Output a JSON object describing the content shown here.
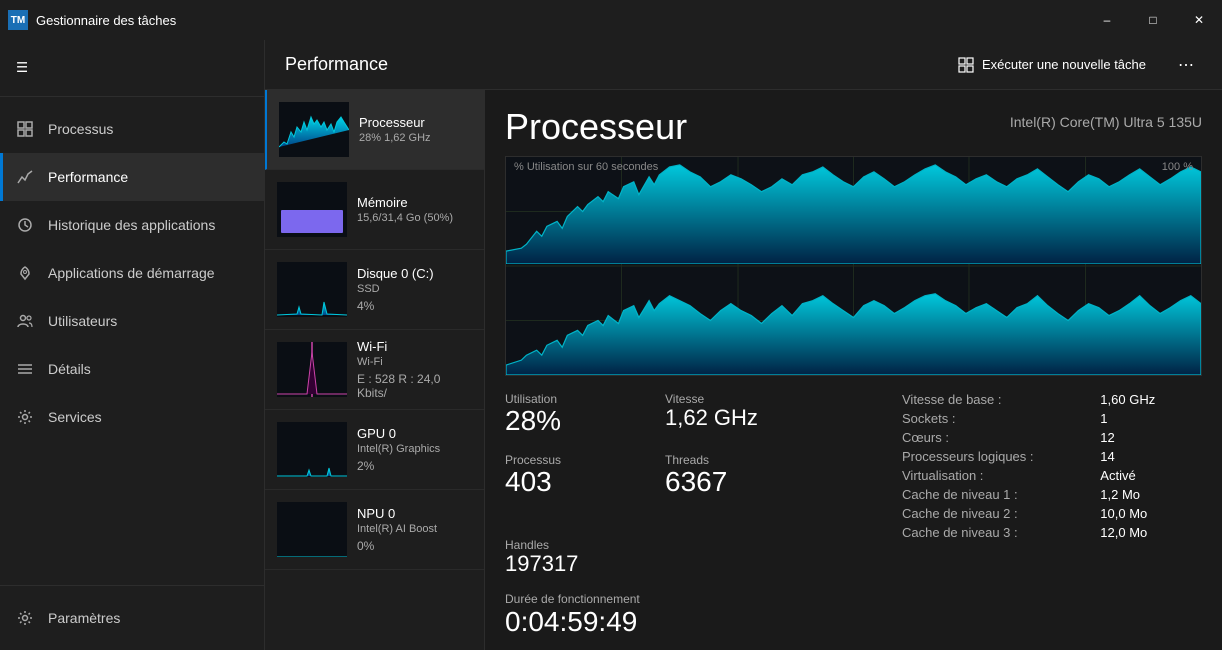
{
  "window": {
    "title": "Gestionnaire des tâches",
    "app_icon": "TM",
    "controls": [
      "–",
      "□",
      "✕"
    ]
  },
  "header": {
    "panel_title": "Performance",
    "run_task_label": "Exécuter une nouvelle tâche",
    "more_icon": "•••"
  },
  "sidebar": {
    "hamburger_icon": "☰",
    "items": [
      {
        "id": "processus",
        "label": "Processus",
        "icon": "grid"
      },
      {
        "id": "performance",
        "label": "Performance",
        "icon": "chart",
        "active": true
      },
      {
        "id": "historique",
        "label": "Historique des applications",
        "icon": "clock"
      },
      {
        "id": "demarrage",
        "label": "Applications de démarrage",
        "icon": "rocket"
      },
      {
        "id": "utilisateurs",
        "label": "Utilisateurs",
        "icon": "users"
      },
      {
        "id": "details",
        "label": "Détails",
        "icon": "list"
      },
      {
        "id": "services",
        "label": "Services",
        "icon": "gear"
      }
    ],
    "bottom_items": [
      {
        "id": "parametres",
        "label": "Paramètres",
        "icon": "settings"
      }
    ]
  },
  "devices": [
    {
      "id": "cpu",
      "name": "Processeur",
      "sub": "28%  1,62 GHz",
      "active": true
    },
    {
      "id": "memory",
      "name": "Mémoire",
      "sub": "15,6/31,4 Go (50%)",
      "type": "memory"
    },
    {
      "id": "disk",
      "name": "Disque 0 (C:)",
      "sub": "SSD",
      "value": "4%"
    },
    {
      "id": "wifi",
      "name": "Wi-Fi",
      "sub": "Wi-Fi",
      "value": "E : 528 R : 24,0 Kbits/"
    },
    {
      "id": "gpu",
      "name": "GPU 0",
      "sub": "Intel(R) Graphics",
      "value": "2%"
    },
    {
      "id": "npu",
      "name": "NPU 0",
      "sub": "Intel(R) AI Boost",
      "value": "0%"
    }
  ],
  "detail": {
    "title": "Processeur",
    "subtitle": "Intel(R) Core(TM) Ultra 5 135U",
    "chart_label": "% Utilisation sur 60 secondes",
    "chart_max": "100 %",
    "stats": {
      "utilisation_label": "Utilisation",
      "utilisation_value": "28%",
      "vitesse_label": "Vitesse",
      "vitesse_value": "1,62 GHz",
      "processus_label": "Processus",
      "processus_value": "403",
      "threads_label": "Threads",
      "threads_value": "6367",
      "handles_label": "Handles",
      "handles_value": "197317",
      "duree_label": "Durée de fonctionnement",
      "duree_value": "0:04:59:49"
    },
    "specs": [
      {
        "label": "Vitesse de base :",
        "value": "1,60 GHz"
      },
      {
        "label": "Sockets :",
        "value": "1"
      },
      {
        "label": "Cœurs :",
        "value": "12"
      },
      {
        "label": "Processeurs logiques :",
        "value": "14"
      },
      {
        "label": "Virtualisation :",
        "value": "Activé"
      },
      {
        "label": "Cache de niveau 1 :",
        "value": "1,2 Mo"
      },
      {
        "label": "Cache de niveau 2 :",
        "value": "10,0 Mo"
      },
      {
        "label": "Cache de niveau 3 :",
        "value": "12,0 Mo"
      }
    ]
  }
}
